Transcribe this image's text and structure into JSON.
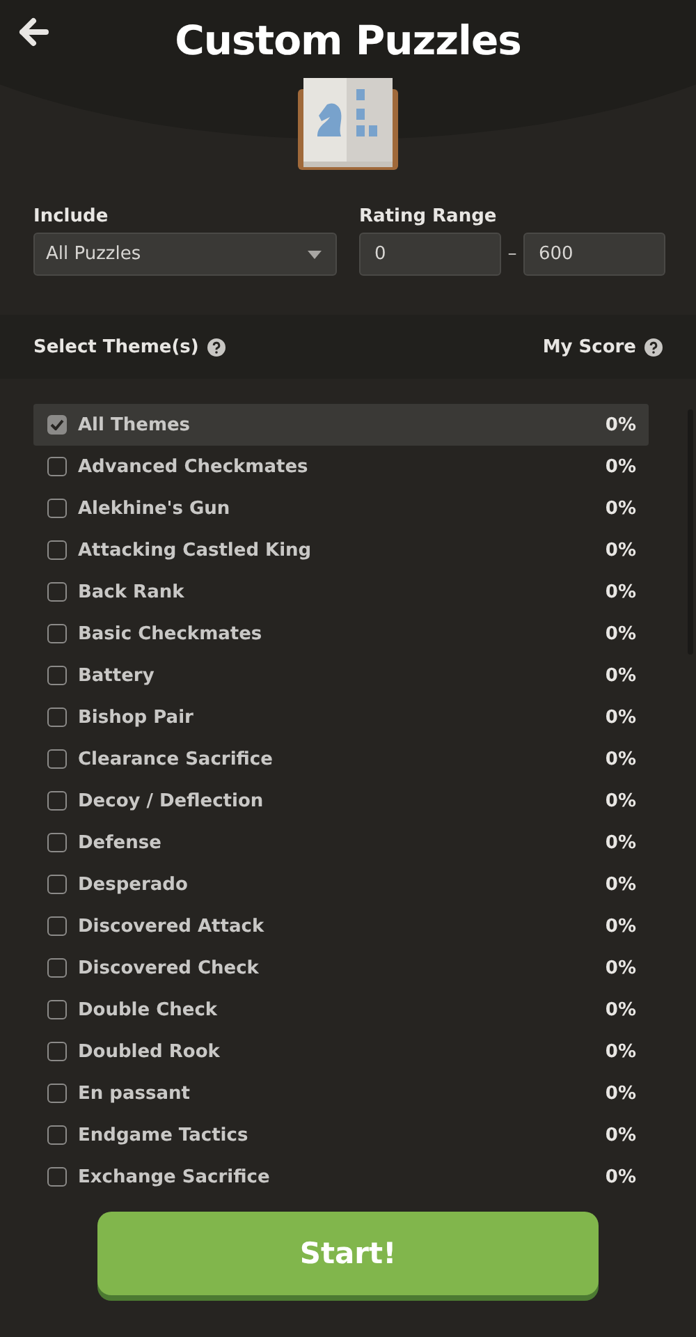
{
  "header": {
    "title": "Custom Puzzles"
  },
  "include": {
    "label": "Include",
    "value": "All Puzzles"
  },
  "rating": {
    "label": "Rating Range",
    "min": "0",
    "separator": "–",
    "max": "600"
  },
  "themes_header": {
    "label": "Select Theme(s)",
    "score_label": "My Score"
  },
  "themes": [
    {
      "name": "All Themes",
      "score": "0%",
      "checked": true,
      "selected": true
    },
    {
      "name": "Advanced Checkmates",
      "score": "0%",
      "checked": false,
      "selected": false
    },
    {
      "name": "Alekhine's Gun",
      "score": "0%",
      "checked": false,
      "selected": false
    },
    {
      "name": "Attacking Castled King",
      "score": "0%",
      "checked": false,
      "selected": false
    },
    {
      "name": "Back Rank",
      "score": "0%",
      "checked": false,
      "selected": false
    },
    {
      "name": "Basic Checkmates",
      "score": "0%",
      "checked": false,
      "selected": false
    },
    {
      "name": "Battery",
      "score": "0%",
      "checked": false,
      "selected": false
    },
    {
      "name": "Bishop Pair",
      "score": "0%",
      "checked": false,
      "selected": false
    },
    {
      "name": "Clearance Sacrifice",
      "score": "0%",
      "checked": false,
      "selected": false
    },
    {
      "name": "Decoy / Deflection",
      "score": "0%",
      "checked": false,
      "selected": false
    },
    {
      "name": "Defense",
      "score": "0%",
      "checked": false,
      "selected": false
    },
    {
      "name": "Desperado",
      "score": "0%",
      "checked": false,
      "selected": false
    },
    {
      "name": "Discovered Attack",
      "score": "0%",
      "checked": false,
      "selected": false
    },
    {
      "name": "Discovered Check",
      "score": "0%",
      "checked": false,
      "selected": false
    },
    {
      "name": "Double Check",
      "score": "0%",
      "checked": false,
      "selected": false
    },
    {
      "name": "Doubled Rook",
      "score": "0%",
      "checked": false,
      "selected": false
    },
    {
      "name": "En passant",
      "score": "0%",
      "checked": false,
      "selected": false
    },
    {
      "name": "Endgame Tactics",
      "score": "0%",
      "checked": false,
      "selected": false
    },
    {
      "name": "Exchange Sacrifice",
      "score": "0%",
      "checked": false,
      "selected": false
    }
  ],
  "start_button": "Start!"
}
